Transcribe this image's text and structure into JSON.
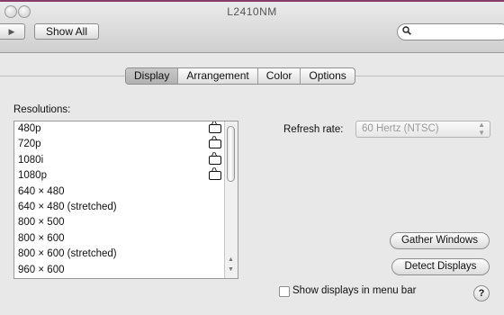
{
  "window": {
    "title": "L2410NM"
  },
  "toolbar": {
    "forward_symbol": "▶",
    "show_all_label": "Show All",
    "search_value": "",
    "search_icon": "magnifier-icon"
  },
  "tabs": [
    {
      "label": "Display",
      "selected": true
    },
    {
      "label": "Arrangement",
      "selected": false
    },
    {
      "label": "Color",
      "selected": false
    },
    {
      "label": "Options",
      "selected": false
    }
  ],
  "resolutions": {
    "label": "Resolutions:",
    "items": [
      {
        "label": "480p",
        "tv_icon": true
      },
      {
        "label": "720p",
        "tv_icon": true
      },
      {
        "label": "1080i",
        "tv_icon": true
      },
      {
        "label": "1080p",
        "tv_icon": true
      },
      {
        "label": "640 × 480",
        "tv_icon": false
      },
      {
        "label": "640 × 480 (stretched)",
        "tv_icon": false
      },
      {
        "label": "800 × 500",
        "tv_icon": false
      },
      {
        "label": "800 × 600",
        "tv_icon": false
      },
      {
        "label": "800 × 600 (stretched)",
        "tv_icon": false
      },
      {
        "label": "960 × 600",
        "tv_icon": false
      }
    ]
  },
  "refresh": {
    "label": "Refresh rate:",
    "selected": "60 Hertz (NTSC)",
    "enabled": false
  },
  "buttons": {
    "gather_windows": "Gather Windows",
    "detect_displays": "Detect Displays"
  },
  "menu_bar_checkbox": {
    "label": "Show displays in menu bar",
    "checked": false
  },
  "help": {
    "label": "?"
  },
  "colors": {
    "accent_top": "#8a3b6a",
    "window_bg": "#e8e8e8"
  }
}
